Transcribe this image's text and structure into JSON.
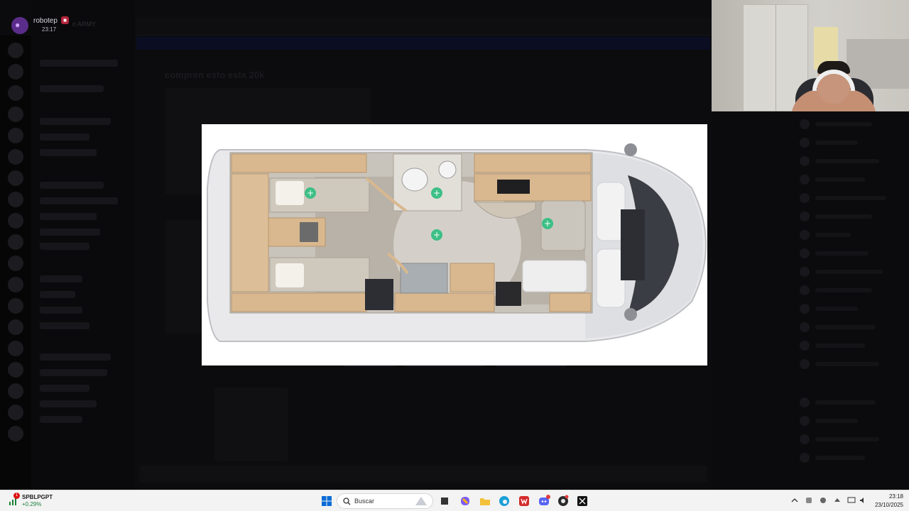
{
  "user": {
    "name": "robotep",
    "status_time": "23:17",
    "server": "n ARMY"
  },
  "background": {
    "post_title": "compren esto esta 20k"
  },
  "modal": {
    "image_kind": "motorhome floor plan",
    "hotspot_icon": "plus-icon",
    "hotspot_color": "#3dbf86",
    "hotspot_count": 4
  },
  "taskbar": {
    "stock_name": "SPBLPGPT",
    "stock_change": "+0.29%",
    "stock_badge": "1",
    "search_placeholder": "Buscar",
    "clock_time": "23:18",
    "clock_date": "23/10/2025",
    "apps": [
      "windows-start-icon",
      "search-icon",
      "task-view-icon",
      "copilot-icon",
      "file-explorer-icon",
      "edge-icon",
      "wps-icon",
      "discord-icon",
      "chrome-icon",
      "capcut-icon"
    ]
  },
  "colors": {
    "accent_green": "#3dbf86",
    "wood": "#d9b88f",
    "floor": "#b8b2a8"
  }
}
